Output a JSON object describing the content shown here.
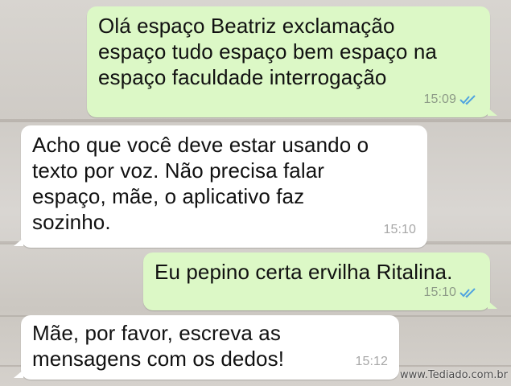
{
  "messages": [
    {
      "direction": "outgoing",
      "text": "Olá espaço Beatriz exclamação\nespaço tudo espaço bem espaço na\nespaço faculdade interrogação",
      "time": "15:09",
      "status_icon": "double-check-icon"
    },
    {
      "direction": "incoming",
      "text": "Acho que você deve estar usando o\ntexto por voz. Não precisa falar\nespaço, mãe, o aplicativo faz\nsozinho.",
      "time": "15:10"
    },
    {
      "direction": "outgoing",
      "text": "Eu pepino certa ervilha Ritalina.",
      "time": "15:10",
      "status_icon": "double-check-icon"
    },
    {
      "direction": "incoming",
      "text": "Mãe, por favor, escreva as\nmensagens com os dedos!",
      "time": "15:12"
    }
  ],
  "watermark": "www.Tediado.com.br",
  "colors": {
    "outgoing_bubble": "#dcf8c6",
    "incoming_bubble": "#ffffff",
    "read_ticks": "#4fa3e0"
  }
}
